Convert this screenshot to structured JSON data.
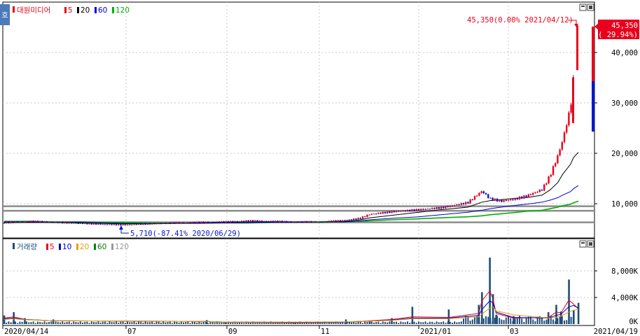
{
  "price_panel": {
    "side_tab": "호",
    "title": "대원미디어",
    "ma_legend": [
      {
        "label": "5",
        "color": "#e8001c"
      },
      {
        "label": "20",
        "color": "#000000"
      },
      {
        "label": "60",
        "color": "#0000cc"
      },
      {
        "label": "120",
        "color": "#00b000"
      }
    ],
    "high_annotation": "45,350(0.00% 2021/04/12)",
    "low_annotation": "5,710(-87.41% 2020/06/29)",
    "current_price": "45,350",
    "current_change": "( 29.94%)",
    "y_tick_labels": [
      "40,000",
      "30,000",
      "20,000",
      "10,000"
    ]
  },
  "volume_panel": {
    "title": "거래량",
    "ma_legend": [
      {
        "label": "5",
        "color": "#e8001c"
      },
      {
        "label": "10",
        "color": "#0000cc"
      },
      {
        "label": "20",
        "color": "#e8a000"
      },
      {
        "label": "60",
        "color": "#008000"
      },
      {
        "label": "120",
        "color": "#999999"
      }
    ],
    "y_tick_labels": [
      "8,000K",
      "4,000K",
      "0K"
    ]
  },
  "x_axis": {
    "labels": [
      "2020/04/14",
      "07",
      "09",
      "11",
      "2021/01",
      "03",
      "2021/04/19"
    ]
  },
  "colors": {
    "up": "#e8001c",
    "down": "#0018cc",
    "volume_bar": "#1f4e79",
    "grid": "#c8c8c8"
  },
  "chart_data": [
    {
      "type": "candlestick",
      "title": "대원미디어",
      "ylim": [
        2000,
        48000
      ],
      "yticks": [
        10000,
        20000,
        30000,
        40000
      ],
      "x": [
        "2020/04/14",
        "2020/05/01",
        "2020/05/15",
        "2020/06/01",
        "2020/06/15",
        "2020/06/29",
        "2020/07/15",
        "2020/08/01",
        "2020/08/15",
        "2020/09/01",
        "2020/09/15",
        "2020/10/01",
        "2020/10/15",
        "2020/11/01",
        "2020/11/15",
        "2020/11/25",
        "2020/12/01",
        "2020/12/15",
        "2021/01/01",
        "2021/01/15",
        "2021/02/01",
        "2021/02/10",
        "2021/02/15",
        "2021/02/22",
        "2021/03/01",
        "2021/03/10",
        "2021/03/20",
        "2021/03/25",
        "2021/03/30",
        "2021/04/02",
        "2021/04/07",
        "2021/04/09",
        "2021/04/12"
      ],
      "series": [
        {
          "name": "5",
          "values": [
            6200,
            6500,
            6300,
            6100,
            5900,
            5800,
            6000,
            6200,
            6300,
            6400,
            6600,
            6500,
            6400,
            6400,
            6700,
            7100,
            7900,
            8400,
            8800,
            9200,
            10200,
            12500,
            11000,
            10500,
            10800,
            11500,
            12800,
            15500,
            19500,
            22500,
            29000,
            35000,
            40000
          ]
        },
        {
          "name": "20",
          "values": [
            6300,
            6300,
            6300,
            6200,
            6100,
            6000,
            6000,
            6100,
            6200,
            6300,
            6400,
            6400,
            6400,
            6400,
            6500,
            6800,
            7200,
            7700,
            8300,
            8800,
            9300,
            10300,
            10600,
            10800,
            11000,
            11200,
            11700,
            12700,
            14200,
            15800,
            17800,
            19200,
            20200
          ]
        },
        {
          "name": "60",
          "values": [
            6400,
            6400,
            6300,
            6300,
            6200,
            6100,
            6100,
            6100,
            6100,
            6200,
            6200,
            6300,
            6300,
            6400,
            6400,
            6600,
            6800,
            7100,
            7400,
            7800,
            8300,
            8700,
            9000,
            9300,
            9600,
            9900,
            10300,
            10700,
            11200,
            11700,
            12400,
            13000,
            13600
          ]
        },
        {
          "name": "120",
          "values": [
            6500,
            6500,
            6400,
            6400,
            6300,
            6300,
            6200,
            6200,
            6200,
            6200,
            6200,
            6300,
            6300,
            6300,
            6400,
            6500,
            6600,
            6800,
            7000,
            7200,
            7400,
            7600,
            7800,
            8000,
            8200,
            8500,
            8700,
            9000,
            9300,
            9600,
            9900,
            10200,
            10500
          ]
        }
      ],
      "high": {
        "value": 45350,
        "date": "2021/04/12",
        "change": "0.00%"
      },
      "low": {
        "value": 5710,
        "date": "2020/06/29",
        "change": "-87.41%"
      },
      "current": {
        "value": 45350,
        "change_pct": 29.94
      },
      "horizontal_levels": [
        6300,
        8600,
        9500
      ]
    },
    {
      "type": "bar",
      "title": "거래량",
      "unit": "K",
      "ylim": [
        0,
        10500
      ],
      "yticks": [
        0,
        4000,
        8000
      ],
      "x": [
        "2020/04/14",
        "2020/04/20",
        "2020/04/27",
        "2020/05/15",
        "2020/08/20",
        "2020/09/01",
        "2020/10/15",
        "2020/11/16",
        "2020/12/01",
        "2020/12/15",
        "2020/12/28",
        "2021/01/20",
        "2021/02/08",
        "2021/02/10",
        "2021/02/15",
        "2021/02/17",
        "2021/02/19",
        "2021/03/02",
        "2021/03/24",
        "2021/03/29",
        "2021/04/01",
        "2021/04/06",
        "2021/04/09",
        "2021/04/12"
      ],
      "values": [
        1300,
        1800,
        900,
        700,
        600,
        300,
        200,
        700,
        400,
        900,
        2600,
        2200,
        2900,
        4800,
        10000,
        4500,
        1400,
        1200,
        1800,
        2900,
        1900,
        6700,
        2100,
        3200
      ],
      "series": [
        {
          "name": "5",
          "values": [
            900,
            1100,
            700,
            500,
            400,
            300,
            200,
            300,
            500,
            700,
            1100,
            1000,
            1600,
            3500,
            5000,
            3800,
            1600,
            900,
            1000,
            1800,
            1700,
            3600,
            3000,
            2300
          ]
        },
        {
          "name": "10",
          "values": [
            800,
            900,
            700,
            500,
            400,
            300,
            250,
            300,
            450,
            600,
            900,
            900,
            1300,
            2200,
            3500,
            3200,
            1800,
            1000,
            900,
            1300,
            1500,
            2600,
            2800,
            2400
          ]
        },
        {
          "name": "20",
          "values": [
            700,
            800,
            650,
            500,
            400,
            300,
            300,
            350,
            450,
            550,
            800,
            800,
            1100,
            1500,
            2400,
            2600,
            2000,
            1400,
            900,
            1000,
            1200,
            1800,
            2100,
            2200
          ]
        }
      ]
    }
  ]
}
